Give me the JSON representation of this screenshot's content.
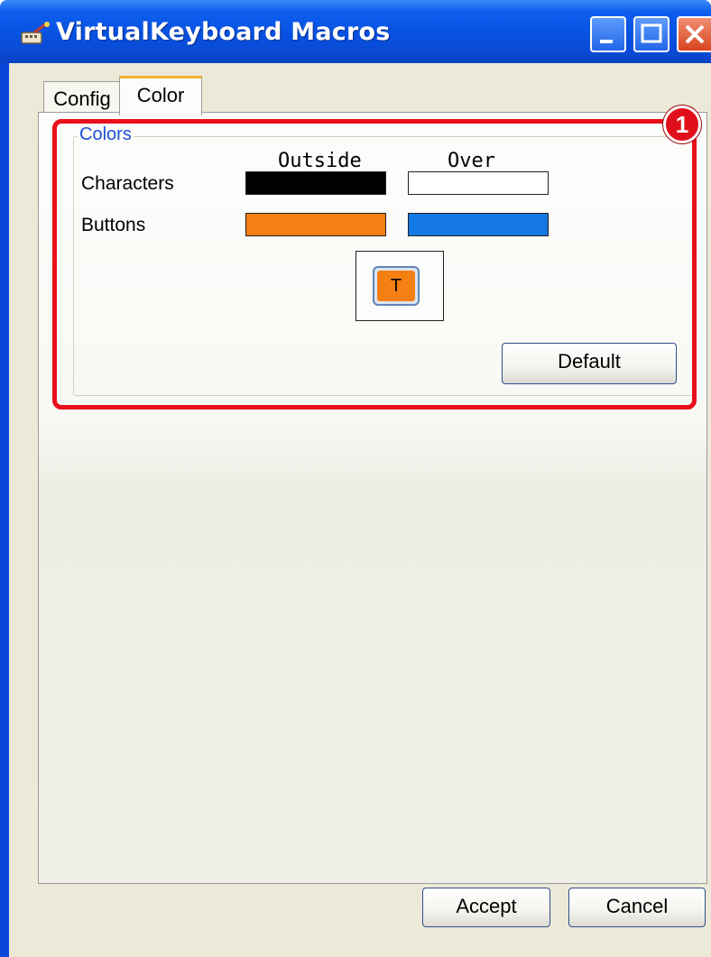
{
  "window": {
    "title": "VirtualKeyboard Macros",
    "icon": "keyboard-wand-icon",
    "controls": [
      "minimize-icon",
      "maximize-icon",
      "close-icon"
    ]
  },
  "tabs": [
    {
      "label": "Config",
      "active": false
    },
    {
      "label": "Color",
      "active": true
    }
  ],
  "colors_group": {
    "legend": "Colors",
    "headers": {
      "outside": "Outside",
      "over": "Over"
    },
    "rows": [
      {
        "label": "Characters",
        "outside_color": "#000000",
        "over_color": "#ffffff"
      },
      {
        "label": "Buttons",
        "outside_color": "#f57f12",
        "over_color": "#1378e4"
      }
    ],
    "preview_button": {
      "label": "T",
      "text_color": "#000000",
      "fill_color": "#f57f12"
    },
    "default_label": "Default"
  },
  "footer": {
    "accept_label": "Accept",
    "cancel_label": "Cancel"
  },
  "annotation": {
    "marker": "1",
    "highlight_color": "#e8101c"
  }
}
